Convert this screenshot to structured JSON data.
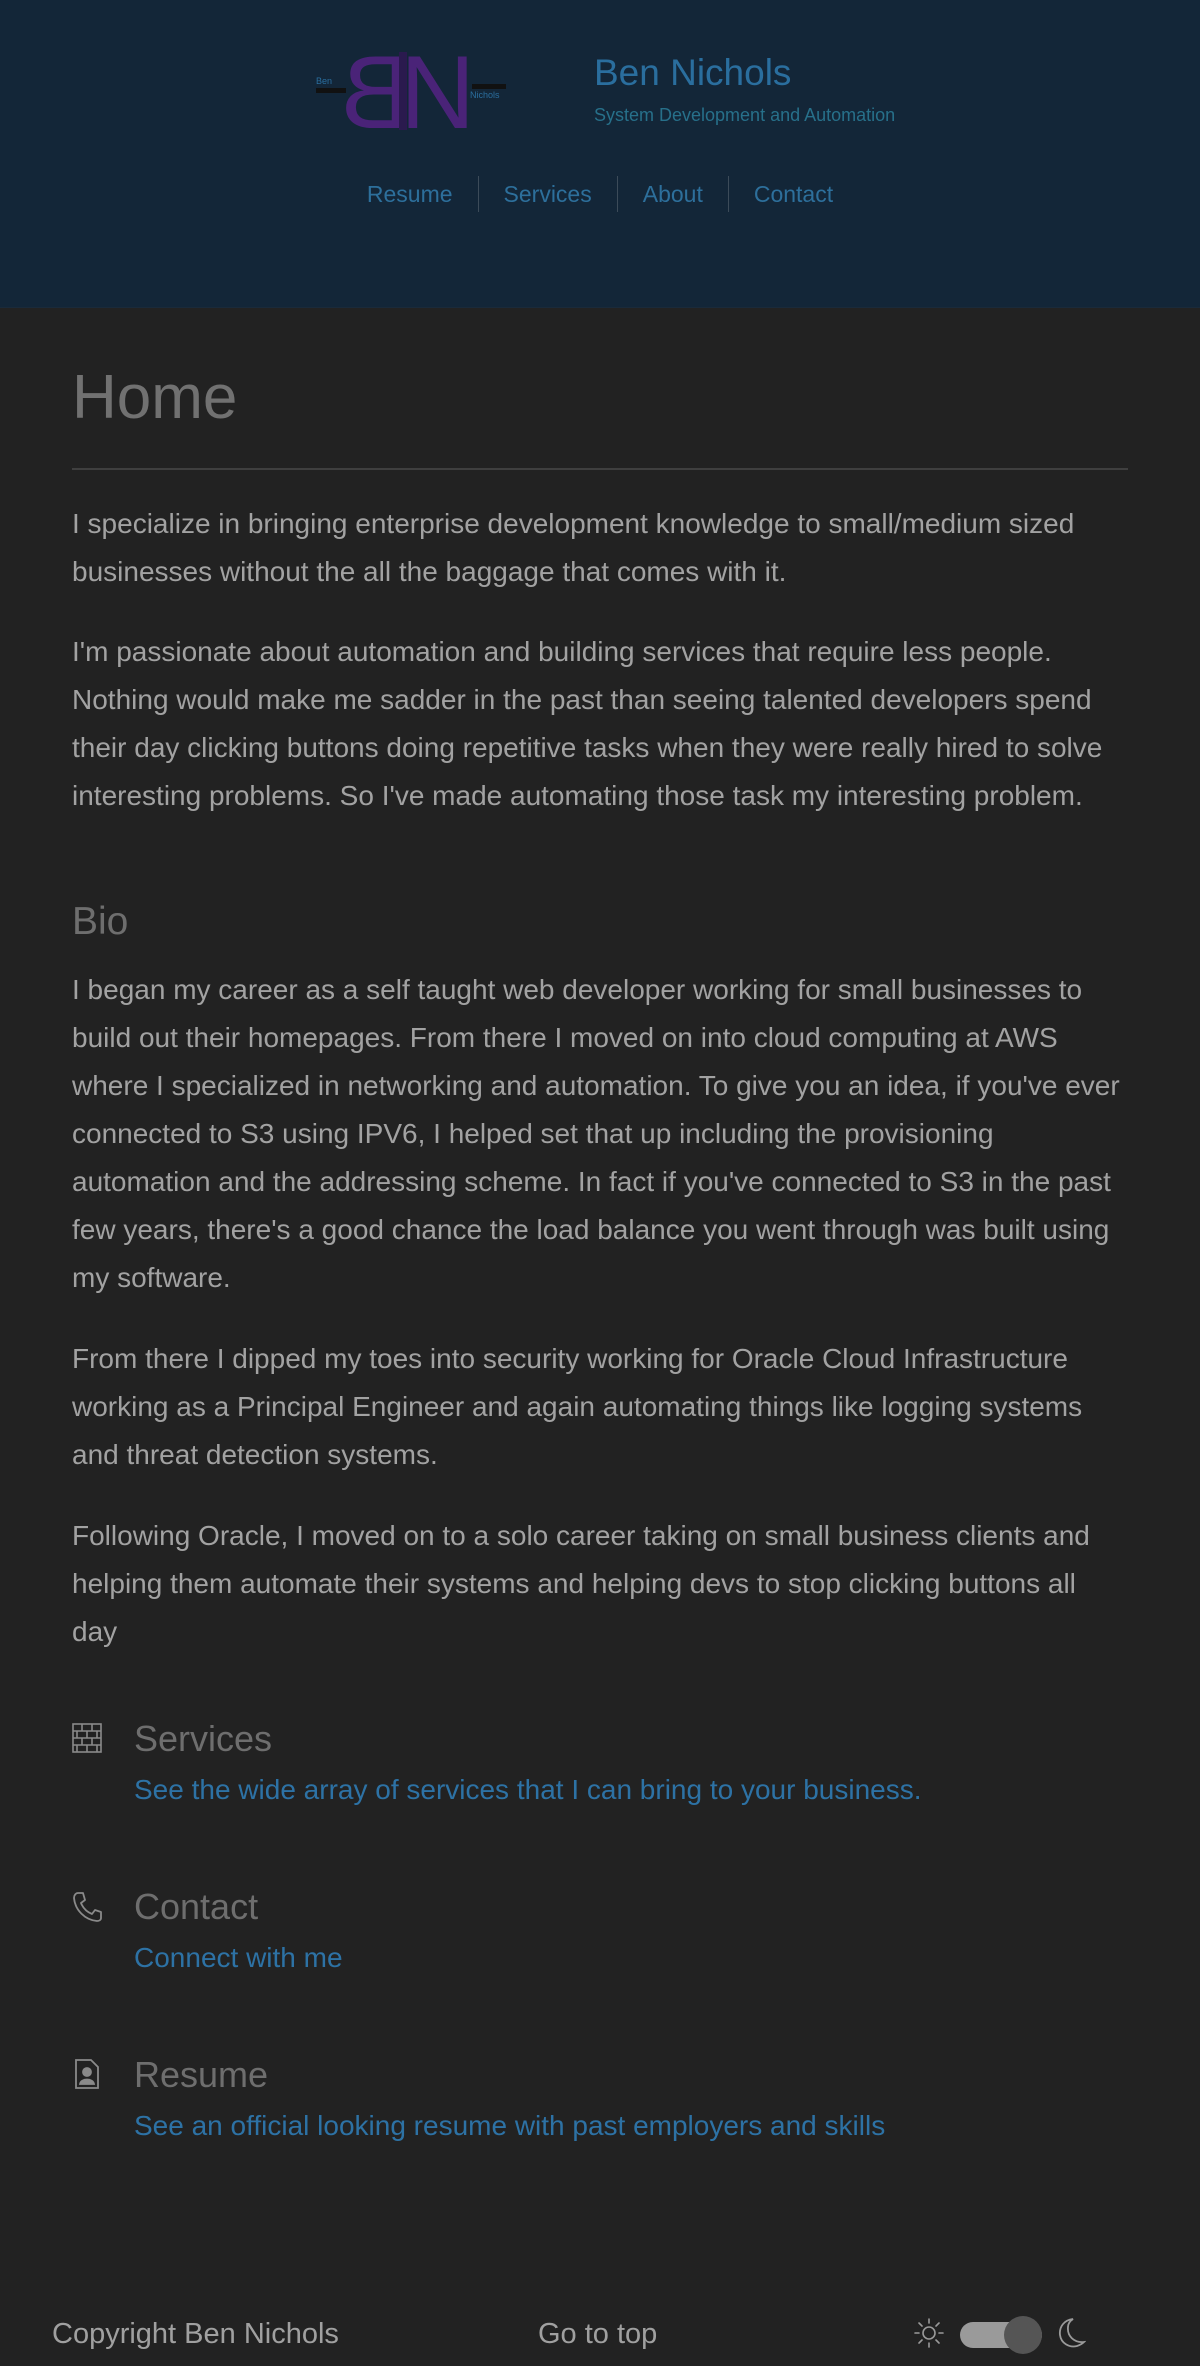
{
  "header": {
    "logo_text": "BN",
    "logo_left_label": "Ben",
    "logo_right_label": "Nichols",
    "title": "Ben Nichols",
    "subtitle": "System Development and Automation",
    "nav": [
      {
        "label": "Resume"
      },
      {
        "label": "Services"
      },
      {
        "label": "About"
      },
      {
        "label": "Contact"
      }
    ]
  },
  "main": {
    "title": "Home",
    "intro": [
      "I specialize in bringing enterprise development knowledge to small/medium sized businesses without the all the baggage that comes with it.",
      "I'm passionate about automation and building services that require less people. Nothing would make me sadder in the past than seeing talented developers spend their day clicking buttons doing repetitive tasks when they were really hired to solve interesting problems. So I've made automating those task my interesting problem."
    ],
    "bio_title": "Bio",
    "bio": [
      "I began my career as a self taught web developer working for small businesses to build out their homepages. From there I moved on into cloud computing at AWS where I specialized in networking and automation. To give you an idea, if you've ever connected to S3 using IPV6, I helped set that up including the provisioning automation and the addressing scheme. In fact if you've connected to S3 in the past few years, there's a good chance the load balance you went through was built using my software.",
      "From there I dipped my toes into security working for Oracle Cloud Infrastructure working as a Principal Engineer and again automating things like logging systems and threat detection systems.",
      "Following Oracle, I moved on to a solo career taking on small business clients and helping them automate their systems and helping devs to stop clicking buttons all day"
    ],
    "cards": [
      {
        "icon": "bricks-icon",
        "title": "Services",
        "link": "See the wide array of services that I can bring to your business."
      },
      {
        "icon": "phone-icon",
        "title": "Contact",
        "link": "Connect with me"
      },
      {
        "icon": "resume-icon",
        "title": "Resume",
        "link": "See an official looking resume with past employers and skills"
      }
    ]
  },
  "footer": {
    "copyright": "Copyright Ben Nichols",
    "go_top": "Go to top",
    "theme_toggle": {
      "left_icon": "sun-icon",
      "right_icon": "moon-icon",
      "state": "dark"
    }
  },
  "colors": {
    "background": "#222222",
    "header_background": "#132638",
    "link": "#2d72a5",
    "logo": "#4a2378"
  }
}
